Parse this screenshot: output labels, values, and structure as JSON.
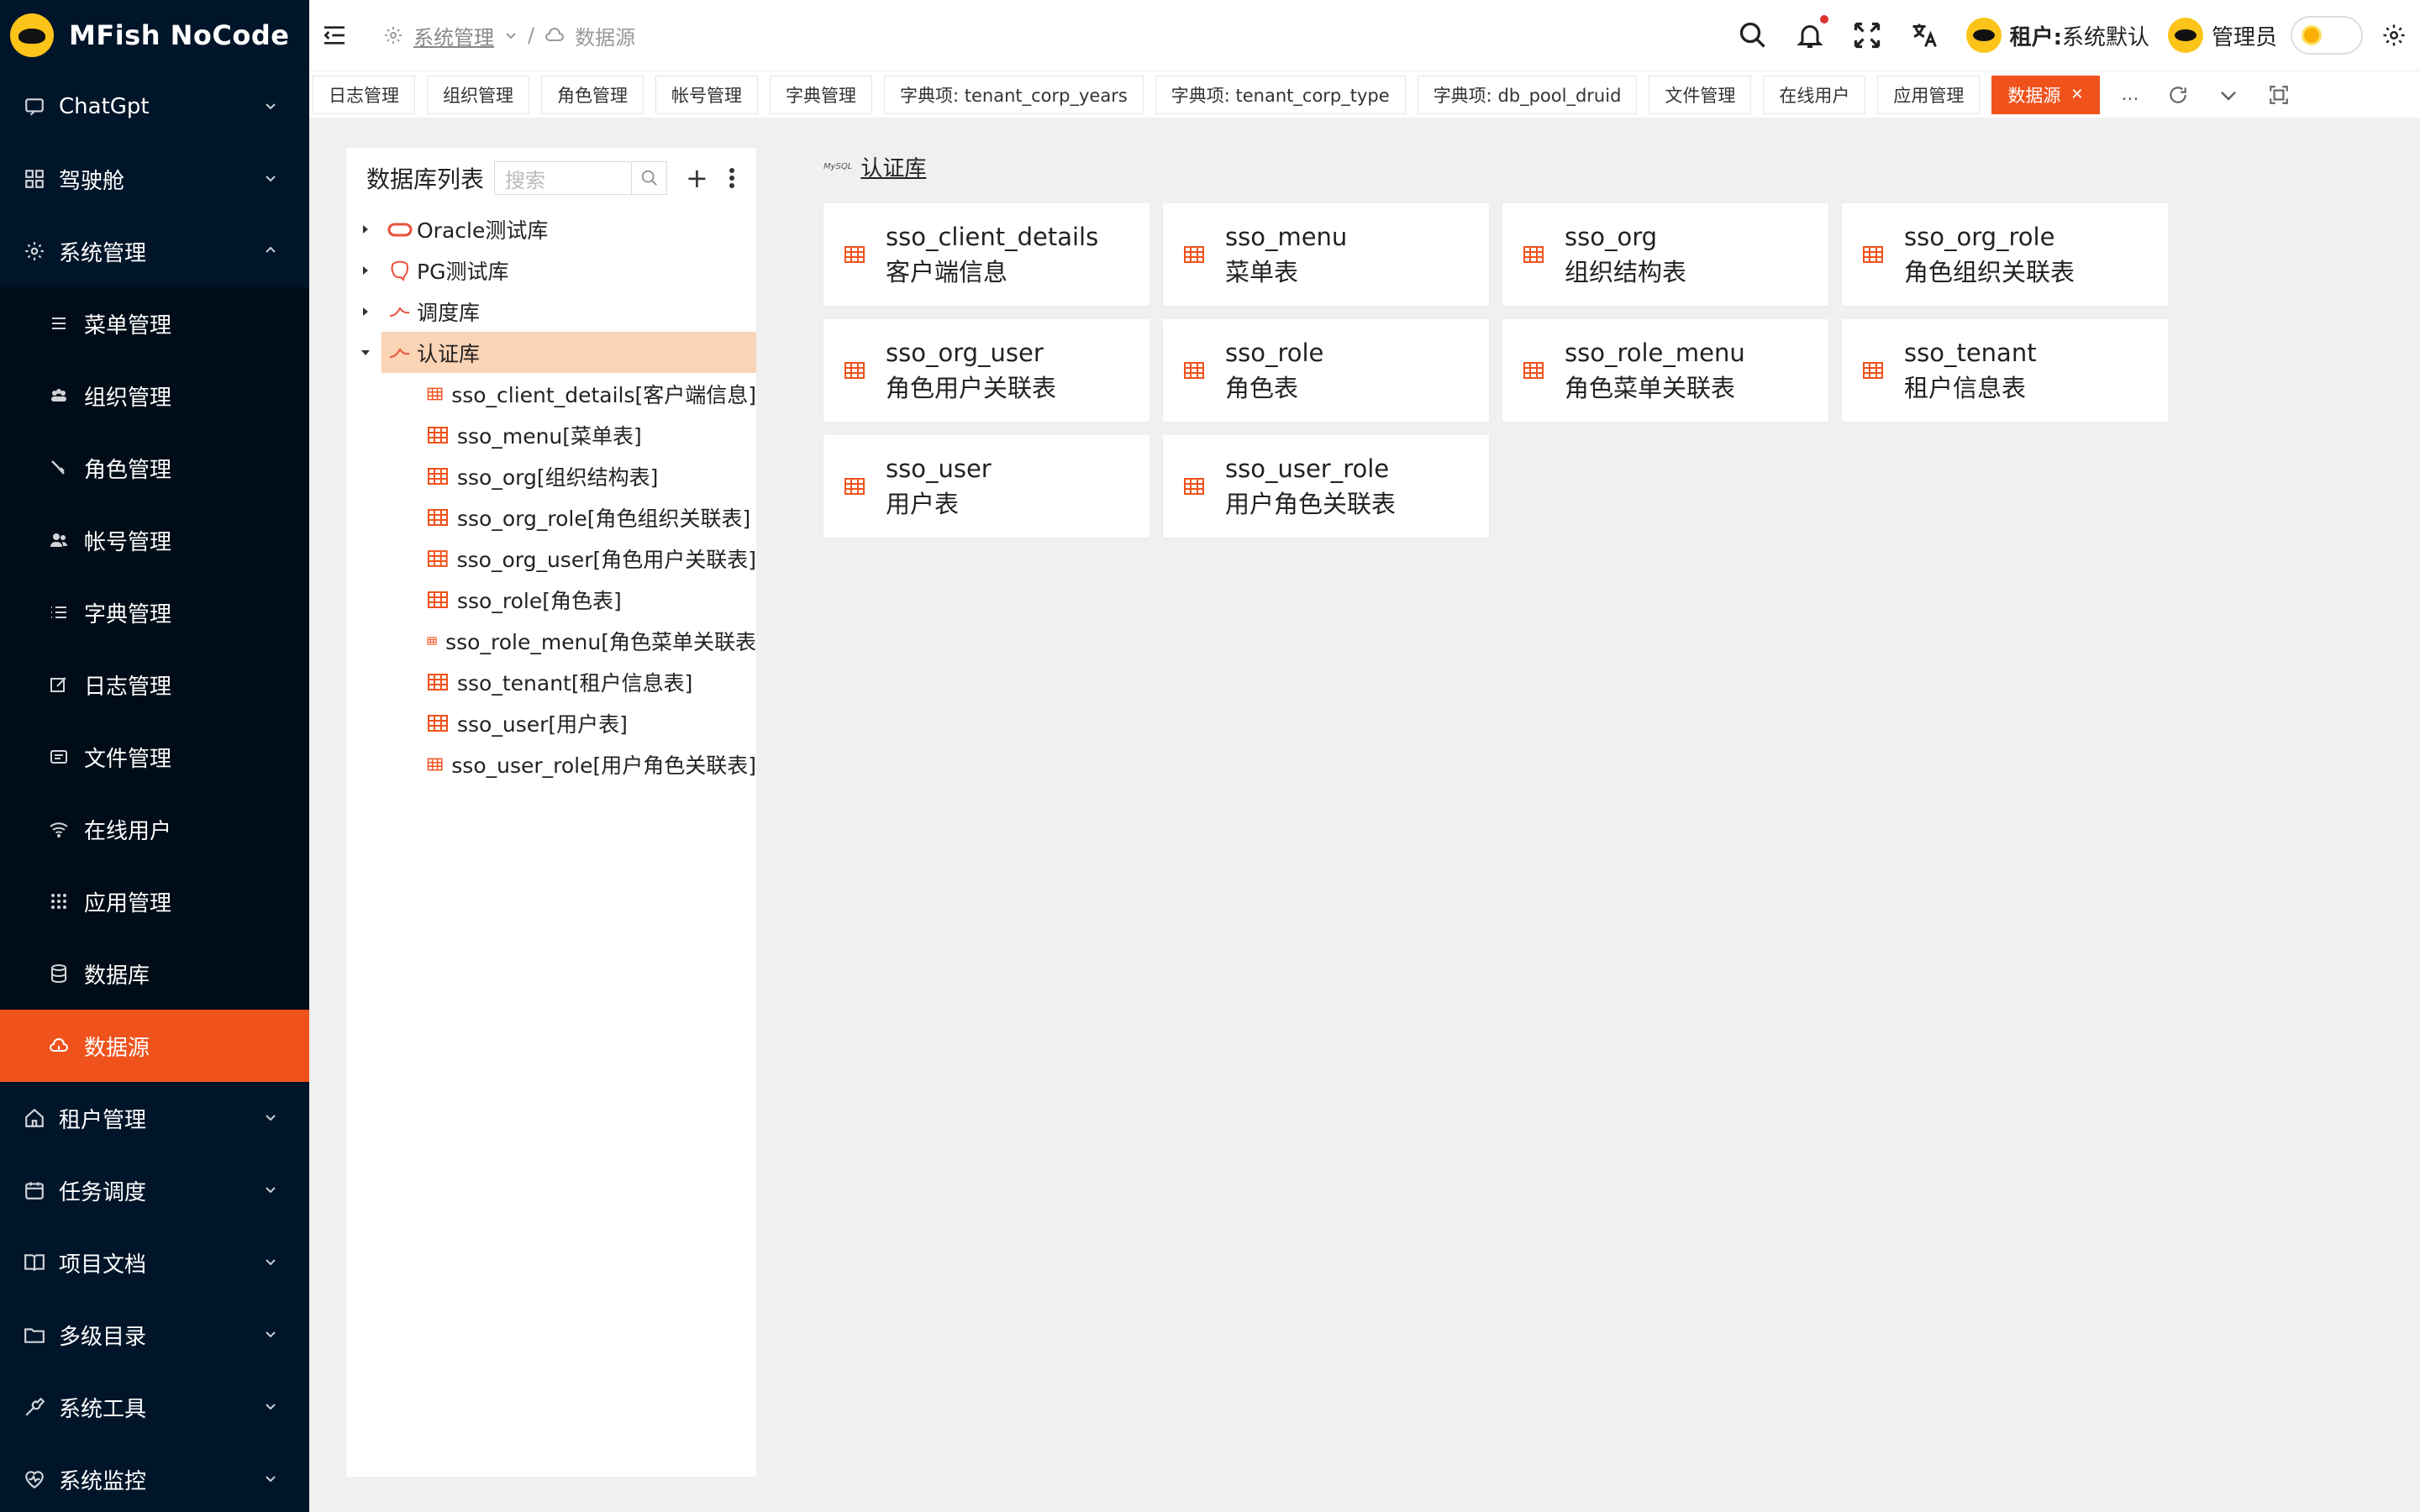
{
  "app": {
    "title": "MFish NoCode"
  },
  "sidebar": {
    "items": [
      {
        "label": "ChatGpt",
        "icon": "chat-icon",
        "arrow": "down"
      },
      {
        "label": "驾驶舱",
        "icon": "dashboard-grid-icon",
        "arrow": "down"
      },
      {
        "label": "系统管理",
        "icon": "gear-icon",
        "arrow": "up"
      }
    ],
    "sub_items": [
      {
        "label": "菜单管理",
        "icon": "menu-lines-icon"
      },
      {
        "label": "组织管理",
        "icon": "org-people-icon"
      },
      {
        "label": "角色管理",
        "icon": "role-icon"
      },
      {
        "label": "帐号管理",
        "icon": "account-icon"
      },
      {
        "label": "字典管理",
        "icon": "list-icon"
      },
      {
        "label": "日志管理",
        "icon": "edit-log-icon"
      },
      {
        "label": "文件管理",
        "icon": "file-icon"
      },
      {
        "label": "在线用户",
        "icon": "wifi-icon"
      },
      {
        "label": "应用管理",
        "icon": "apps-icon"
      },
      {
        "label": "数据库",
        "icon": "database-icon"
      },
      {
        "label": "数据源",
        "icon": "cloud-source-icon"
      }
    ],
    "bottom_items": [
      {
        "label": "租户管理",
        "icon": "home-icon"
      },
      {
        "label": "任务调度",
        "icon": "calendar-icon"
      },
      {
        "label": "项目文档",
        "icon": "book-icon"
      },
      {
        "label": "多级目录",
        "icon": "folder-icon"
      },
      {
        "label": "系统工具",
        "icon": "tool-icon"
      },
      {
        "label": "系统监控",
        "icon": "heart-monitor-icon"
      }
    ]
  },
  "breadcrumb": {
    "parent": "系统管理",
    "current": "数据源",
    "separator": "/"
  },
  "header": {
    "tenant_label": "租户:",
    "tenant_value": "系统默认",
    "user": "管理员"
  },
  "tabs": [
    {
      "label": "日志管理"
    },
    {
      "label": "组织管理"
    },
    {
      "label": "角色管理"
    },
    {
      "label": "帐号管理"
    },
    {
      "label": "字典管理"
    },
    {
      "label": "字典项: tenant_corp_years"
    },
    {
      "label": "字典项: tenant_corp_type"
    },
    {
      "label": "字典项: db_pool_druid"
    },
    {
      "label": "文件管理"
    },
    {
      "label": "在线用户"
    },
    {
      "label": "应用管理"
    },
    {
      "label": "数据源",
      "active": true
    }
  ],
  "tab_tools": {
    "more": "..."
  },
  "tree": {
    "title": "数据库列表",
    "search_placeholder": "搜索",
    "add": "+",
    "databases": [
      {
        "label": "Oracle测试库",
        "icon": "oracle-icon",
        "expanded": false
      },
      {
        "label": "PG测试库",
        "icon": "postgres-icon",
        "expanded": false
      },
      {
        "label": "调度库",
        "icon": "mysql-icon",
        "expanded": false
      },
      {
        "label": "认证库",
        "icon": "mysql-icon",
        "expanded": true,
        "selected": true
      }
    ],
    "tables": [
      "sso_client_details[客户端信息]",
      "sso_menu[菜单表]",
      "sso_org[组织结构表]",
      "sso_org_role[角色组织关联表]",
      "sso_org_user[角色用户关联表]",
      "sso_role[角色表]",
      "sso_role_menu[角色菜单关联表",
      "sso_tenant[租户信息表]",
      "sso_user[用户表]",
      "sso_user_role[用户角色关联表]"
    ]
  },
  "content": {
    "db_title": "认证库",
    "db_badge": "MySQL",
    "cards": [
      {
        "name": "sso_client_details",
        "desc": "客户端信息"
      },
      {
        "name": "sso_menu",
        "desc": "菜单表"
      },
      {
        "name": "sso_org",
        "desc": "组织结构表"
      },
      {
        "name": "sso_org_role",
        "desc": "角色组织关联表"
      },
      {
        "name": "sso_org_user",
        "desc": "角色用户关联表"
      },
      {
        "name": "sso_role",
        "desc": "角色表"
      },
      {
        "name": "sso_role_menu",
        "desc": "角色菜单关联表"
      },
      {
        "name": "sso_tenant",
        "desc": "租户信息表"
      },
      {
        "name": "sso_user",
        "desc": "用户表"
      },
      {
        "name": "sso_user_role",
        "desc": "用户角色关联表"
      }
    ]
  },
  "colors": {
    "accent": "#f0521c",
    "sidebar_bg": "#001529",
    "selected_row": "#fbd3b5"
  }
}
